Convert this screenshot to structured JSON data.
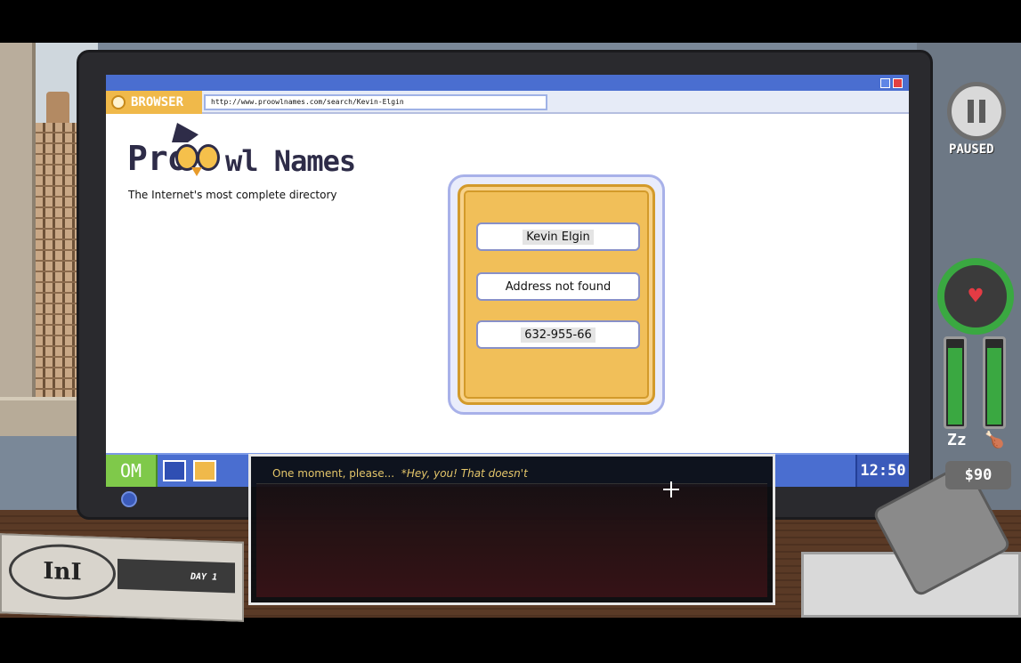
{
  "browser": {
    "tab_label": "BROWSER",
    "url": "http://www.proowlnames.com/search/Kevin-Elgin"
  },
  "site": {
    "logo_left": "Pro",
    "logo_right": "wl Names",
    "tagline": "The Internet's most complete directory"
  },
  "result": {
    "name": "Kevin Elgin",
    "address": "Address not found",
    "phone": "632-955-66"
  },
  "taskbar": {
    "start_label": "OM",
    "clock": "12:50"
  },
  "dialogue": {
    "line": "One moment, please...",
    "quote": "*Hey, you! That doesn't"
  },
  "newspaper": {
    "masthead": "InI",
    "day": "DAY 1"
  },
  "hud": {
    "status": "PAUSED",
    "money": "$90",
    "sleep_level": 0.92,
    "hunger_level": 0.92
  },
  "colors": {
    "accent": "#4a6ed0",
    "card": "#f1bf59",
    "health": "#3aa841"
  }
}
